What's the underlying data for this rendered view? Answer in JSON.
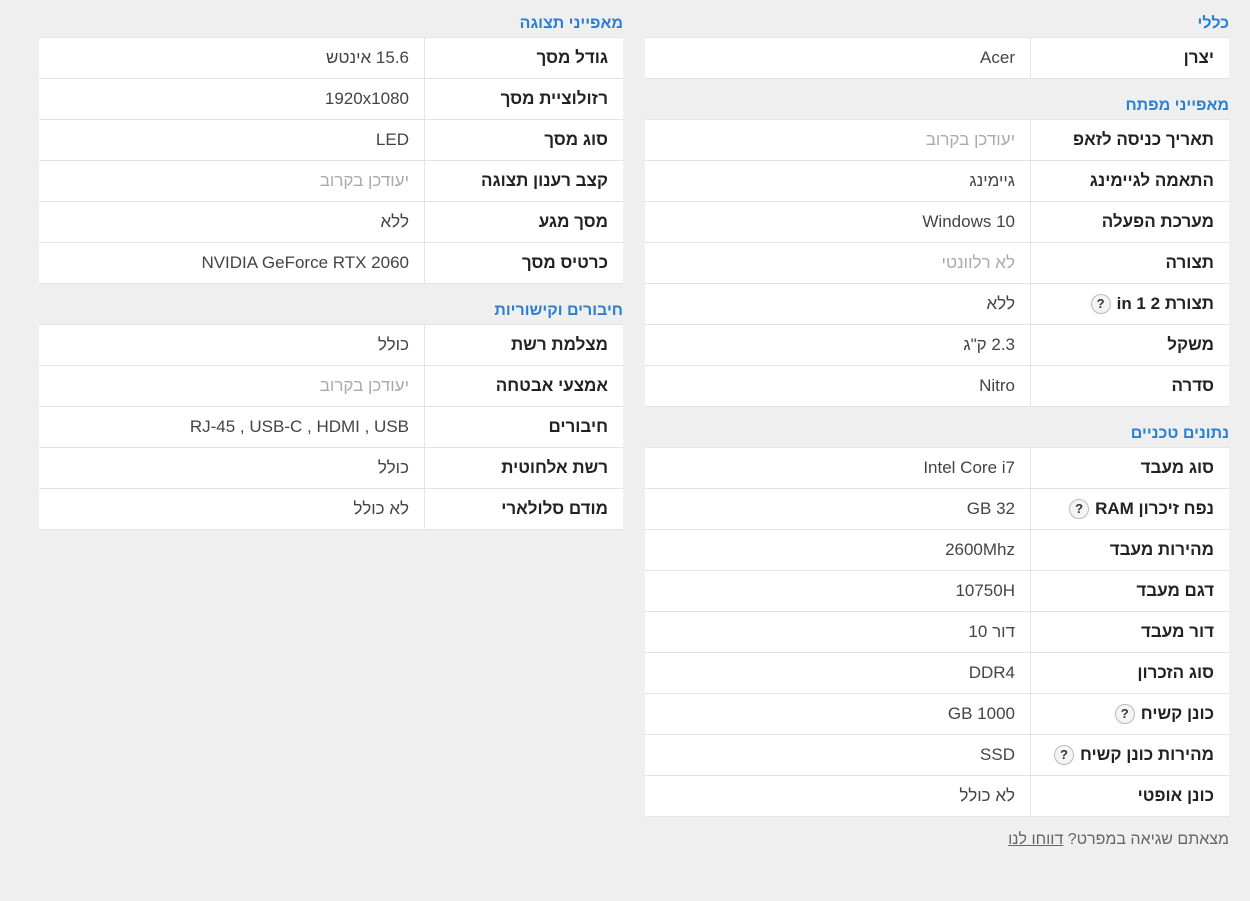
{
  "right": {
    "general": {
      "title": "כללי",
      "rows": [
        {
          "k": "יצרן",
          "v": "Acer"
        }
      ]
    },
    "key": {
      "title": "מאפייני מפתח",
      "rows": [
        {
          "k": "תאריך כניסה לזאפ",
          "v": "יעודכן בקרוב"
        },
        {
          "k": "התאמה לגיימינג",
          "v": "גיימינג"
        },
        {
          "k": "מערכת הפעלה",
          "v": "Windows 10"
        },
        {
          "k": "תצורה",
          "v": "לא רלוונטי"
        },
        {
          "k": "תצורת 2 in 1",
          "v": "ללא",
          "help": "?"
        },
        {
          "k": "משקל",
          "v": "2.3 ק\"ג"
        },
        {
          "k": "סדרה",
          "v": "Nitro"
        }
      ]
    },
    "tech": {
      "title": "נתונים טכניים",
      "rows": [
        {
          "k": "סוג מעבד",
          "v": "Intel Core i7"
        },
        {
          "k": "נפח זיכרון RAM",
          "v": "32 GB",
          "help": "?"
        },
        {
          "k": "מהירות מעבד",
          "v": "2600Mhz"
        },
        {
          "k": "דגם מעבד",
          "v": "10750H"
        },
        {
          "k": "דור מעבד",
          "v": "דור 10"
        },
        {
          "k": "סוג הזכרון",
          "v": "DDR4"
        },
        {
          "k": "כונן קשיח",
          "v": "1000 GB",
          "help": "?"
        },
        {
          "k": "מהירות כונן קשיח",
          "v": "SSD",
          "help": "?"
        },
        {
          "k": "כונן אופטי",
          "v": "לא כולל"
        }
      ]
    },
    "report": {
      "text": "מצאתם שגיאה במפרט?",
      "link": "דווחו לנו"
    }
  },
  "left": {
    "display": {
      "title": "מאפייני תצוגה",
      "rows": [
        {
          "k": "גודל מסך",
          "v": "15.6 אינטש"
        },
        {
          "k": "רזולוציית מסך",
          "v": "1920x1080"
        },
        {
          "k": "סוג מסך",
          "v": "LED"
        },
        {
          "k": "קצב רענון תצוגה",
          "v": "יעודכן בקרוב"
        },
        {
          "k": "מסך מגע",
          "v": "ללא"
        },
        {
          "k": "כרטיס מסך",
          "v": "NVIDIA GeForce RTX 2060"
        }
      ]
    },
    "connectivity": {
      "title": "חיבורים וקישוריות",
      "rows": [
        {
          "k": "מצלמת רשת",
          "v": "כולל"
        },
        {
          "k": "אמצעי אבטחה",
          "v": "יעודכן בקרוב"
        },
        {
          "k": "חיבורים",
          "v": "RJ-45 , USB-C , HDMI , USB"
        },
        {
          "k": "רשת אלחוטית",
          "v": "כולל"
        },
        {
          "k": "מודם סלולארי",
          "v": "לא כולל"
        }
      ]
    }
  }
}
